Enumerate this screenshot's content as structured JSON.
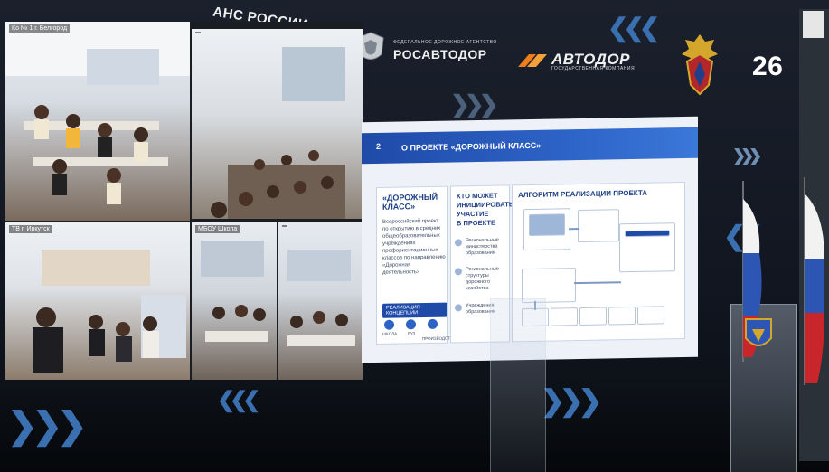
{
  "header": {
    "agency_text": "АНС РОССИИ",
    "rosavtodor_small": "ФЕДЕРАЛЬНОЕ ДОРОЖНОЕ АГЕНТСТВО",
    "rosavtodor": "РОСАВТОДОР",
    "avtodor": "АВТОДОР",
    "avtodor_small": "ГОСУДАРСТВЕННАЯ КОМПАНИЯ",
    "region_number": "26"
  },
  "video_wall": {
    "cameras": [
      {
        "label": "Ко № 1 г. Белгород"
      },
      {
        "label": ""
      },
      {
        "label": "ТВ г. Иркутск"
      },
      {
        "label": "МБОУ Школа"
      },
      {
        "label": ""
      }
    ]
  },
  "slide": {
    "number": "2",
    "title": "О ПРОЕКТЕ «ДОРОЖНЫЙ КЛАСС»",
    "col1": {
      "heading_1": "«ДОРОЖНЫЙ",
      "heading_2": "КЛАСС»",
      "body": [
        "Всероссийский проект",
        "по открытию в средних",
        "общеобразовательных",
        "учреждениях",
        "профориентационных",
        "классов по направлению",
        "«Дорожная",
        "деятельность»"
      ],
      "button": "РЕАЛИЗАЦИЯ КОНЦЕПЦИИ",
      "icons": [
        "ШКОЛА",
        "ВУЗ",
        "ПРОИЗВОДСТВО"
      ]
    },
    "col2": {
      "heading": [
        "КТО МОЖЕТ",
        "ИНИЦИИРОВАТЬ",
        "УЧАСТИЕ",
        "В ПРОЕКТЕ"
      ],
      "items": [
        [
          "Региональные",
          "министерства",
          "образования"
        ],
        [
          "Региональные",
          "структуры",
          "дорожного",
          "хозяйства"
        ],
        [
          "Учреждения",
          "образования"
        ]
      ]
    },
    "col3": {
      "heading": "АЛГОРИТМ РЕАЛИЗАЦИИ ПРОЕКТА"
    }
  },
  "colors": {
    "slide_blue": "#1f4aa8",
    "chevron_blue": "#3a6fb0"
  }
}
